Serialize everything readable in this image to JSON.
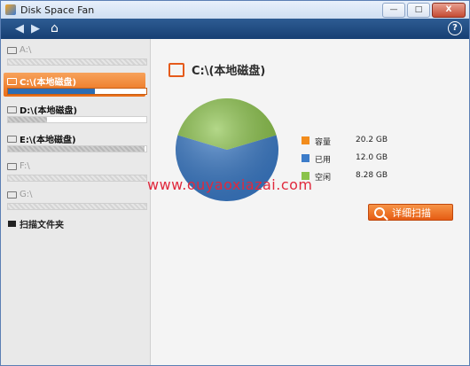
{
  "window": {
    "title": "Disk Space Fan"
  },
  "titlebar_buttons": {
    "minimize": "—",
    "maximize": "□",
    "close": "X"
  },
  "toolbar": {
    "help": "?"
  },
  "sidebar": {
    "drives": [
      {
        "label": "A:\\",
        "usage": null
      },
      {
        "label": "C:\\(本地磁盘)",
        "usage": 0.63,
        "selected": true
      },
      {
        "label": "D:\\(本地磁盘)",
        "usage": 0.28
      },
      {
        "label": "E:\\(本地磁盘)",
        "usage": 0.99
      },
      {
        "label": "F:\\",
        "usage": null
      },
      {
        "label": "G:\\",
        "usage": null
      }
    ],
    "scan_folder": "扫描文件夹"
  },
  "main": {
    "drive_title": "C:\\(本地磁盘)",
    "legend": [
      {
        "label": "容量",
        "value": "20.2 GB",
        "color": "#f28c1c"
      },
      {
        "label": "已用",
        "value": "12.0 GB",
        "color": "#3c7cc9"
      },
      {
        "label": "空闲",
        "value": "8.28 GB",
        "color": "#8bc34a"
      }
    ],
    "scan_button": "详细扫描"
  },
  "chart_data": {
    "type": "pie",
    "slices": [
      {
        "label": "已用",
        "value": 12.0,
        "color": "#3c7cc9"
      },
      {
        "label": "空闲",
        "value": 8.28,
        "color": "#8bc34a"
      }
    ]
  },
  "watermark": "www.ouyaoxiazai.com"
}
